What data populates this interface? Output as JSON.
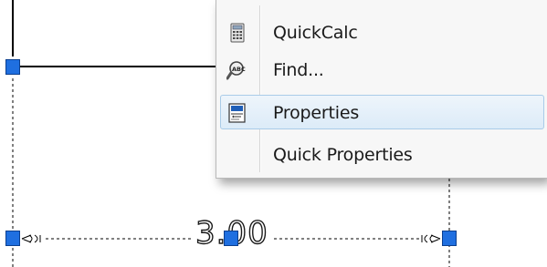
{
  "drawing": {
    "dimension_text": "3.00",
    "grip_color": "#1f6fe0",
    "line_color": "#000000"
  },
  "context_menu": {
    "items": [
      {
        "label": "QuickCalc",
        "icon": "calculator-icon",
        "selected": false
      },
      {
        "label": "Find...",
        "icon": "find-replace-icon",
        "selected": false
      },
      {
        "label": "Properties",
        "icon": "properties-icon",
        "selected": true
      },
      {
        "label": "Quick Properties",
        "icon": "",
        "selected": false
      }
    ],
    "highlight_color": "#dcebf8",
    "highlight_border": "#a9cbe8"
  }
}
